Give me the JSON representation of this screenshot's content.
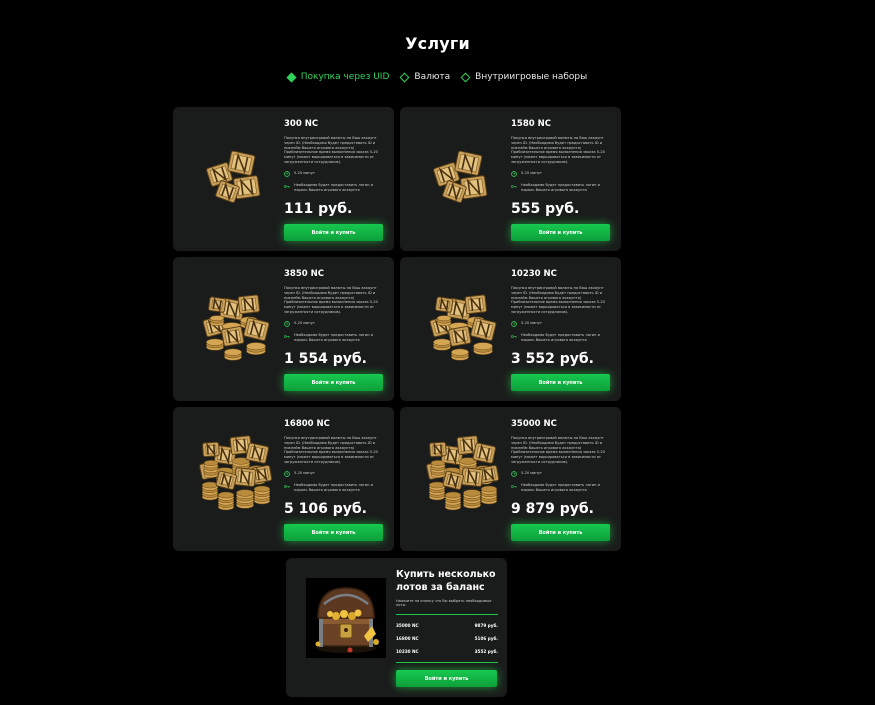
{
  "page": {
    "title": "Услуги"
  },
  "filters": [
    {
      "label": "Покупка через UID",
      "active": true
    },
    {
      "label": "Валюта",
      "active": false
    },
    {
      "label": "Внутриигровые наборы",
      "active": false
    }
  ],
  "products": [
    {
      "title": "300 NC",
      "description": "Покупка внутриигровой валюты на Ваш аккаунт через ID. (Необходимо будет предоставить ID и никнейм Вашего игрового аккаунта) Приблизительное время выполнения заказа 5-20 минут (может варьироваться в зависимости от загруженности сотрудников).",
      "time": "5-20 минут",
      "note": "Необходимо будет предоставить логин и пароль Вашего игрового аккаунта",
      "price": "111 руб.",
      "button": "Войти и купить",
      "icon": "nc-coins-small-icon"
    },
    {
      "title": "1580 NC",
      "description": "Покупка внутриигровой валюты на Ваш аккаунт через ID. (Необходимо будет предоставить ID и никнейм Вашего игрового аккаунта) Приблизительное время выполнения заказа 5-20 минут (может варьироваться в зависимости от загруженности сотрудников).",
      "time": "5-20 минут",
      "note": "Необходимо будет предоставить логин и пароль Вашего игрового аккаунта",
      "price": "555 руб.",
      "button": "Войти и купить",
      "icon": "nc-coins-small-icon"
    },
    {
      "title": "3850 NC",
      "description": "Покупка внутриигровой валюты на Ваш аккаунт через ID. (Необходимо будет предоставить ID и никнейм Вашего игрового аккаунта) Приблизительное время выполнения заказа 5-20 минут (может варьироваться в зависимости от загруженности сотрудников).",
      "time": "5-20 минут",
      "note": "Необходимо будет предоставить логин и пароль Вашего игрового аккаунта",
      "price": "1 554 руб.",
      "button": "Войти и купить",
      "icon": "nc-coins-medium-icon"
    },
    {
      "title": "10230 NC",
      "description": "Покупка внутриигровой валюты на Ваш аккаунт через ID. (Необходимо будет предоставить ID и никнейм Вашего игрового аккаунта) Приблизительное время выполнения заказа 5-20 минут (может варьироваться в зависимости от загруженности сотрудников).",
      "time": "5-20 минут",
      "note": "Необходимо будет предоставить логин и пароль Вашего игрового аккаунта",
      "price": "3 552 руб.",
      "button": "Войти и купить",
      "icon": "nc-coins-medium-icon"
    },
    {
      "title": "16800 NC",
      "description": "Покупка внутриигровой валюты на Ваш аккаунт через ID. (Необходимо будет предоставить ID и никнейм Вашего игрового аккаунта) Приблизительное время выполнения заказа 5-20 минут (может варьироваться в зависимости от загруженности сотрудников).",
      "time": "5-20 минут",
      "note": "Необходимо будет предоставить логин и пароль Вашего игрового аккаунта",
      "price": "5 106 руб.",
      "button": "Войти и купить",
      "icon": "nc-coins-large-icon"
    },
    {
      "title": "35000 NC",
      "description": "Покупка внутриигровой валюты на Ваш аккаунт через ID. (Необходимо будет предоставить ID и никнейм Вашего игрового аккаунта) Приблизительное время выполнения заказа 5-20 минут (может варьироваться в зависимости от загруженности сотрудников).",
      "time": "5-20 минут",
      "note": "Необходимо будет предоставить логин и пароль Вашего игрового аккаунта",
      "price": "9 879 руб.",
      "button": "Войти и купить",
      "icon": "nc-coins-large-icon"
    }
  ],
  "bundle": {
    "title": "Купить несколько лотов за баланс",
    "description": "Нажмите на кнопку что бы выбрать необходимые лоты",
    "items": [
      {
        "name": "35000 NC",
        "price": "9879 руб."
      },
      {
        "name": "16800 NC",
        "price": "5106 руб."
      },
      {
        "name": "10230 NC",
        "price": "3552 руб."
      }
    ],
    "button": "Войти и купить",
    "icon": "treasure-chest-icon"
  },
  "colors": {
    "accent": "#2fd35a",
    "card_bg": "#1a1c1b",
    "page_bg": "#000000",
    "button": "#16c94f"
  }
}
